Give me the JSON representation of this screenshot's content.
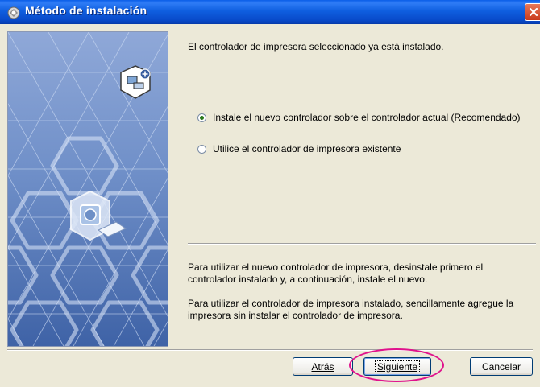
{
  "window": {
    "title": "Método de instalación"
  },
  "content": {
    "message": "El controlador de impresora seleccionado ya está instalado.",
    "options": [
      {
        "label": "Instale el nuevo controlador sobre el controlador actual (Recomendado)",
        "checked": true
      },
      {
        "label": "Utilice el controlador de impresora existente",
        "checked": false
      }
    ],
    "note1_line1": "Para utilizar el nuevo controlador de impresora, desinstale primero el",
    "note1_line2": "controlador instalado y, a continuación, instale el nuevo.",
    "note2_line1": "Para utilizar el controlador de impresora instalado, sencillamente agregue la",
    "note2_line2": "impresora sin instalar el controlador de impresora."
  },
  "buttons": {
    "back": "Atrás",
    "next": "Siguiente",
    "cancel": "Cancelar"
  },
  "colors": {
    "titlebar": "#0a5ee8",
    "dialog_bg": "#ece9d8",
    "highlight": "#e0128c",
    "banner": "#6e90c8"
  }
}
